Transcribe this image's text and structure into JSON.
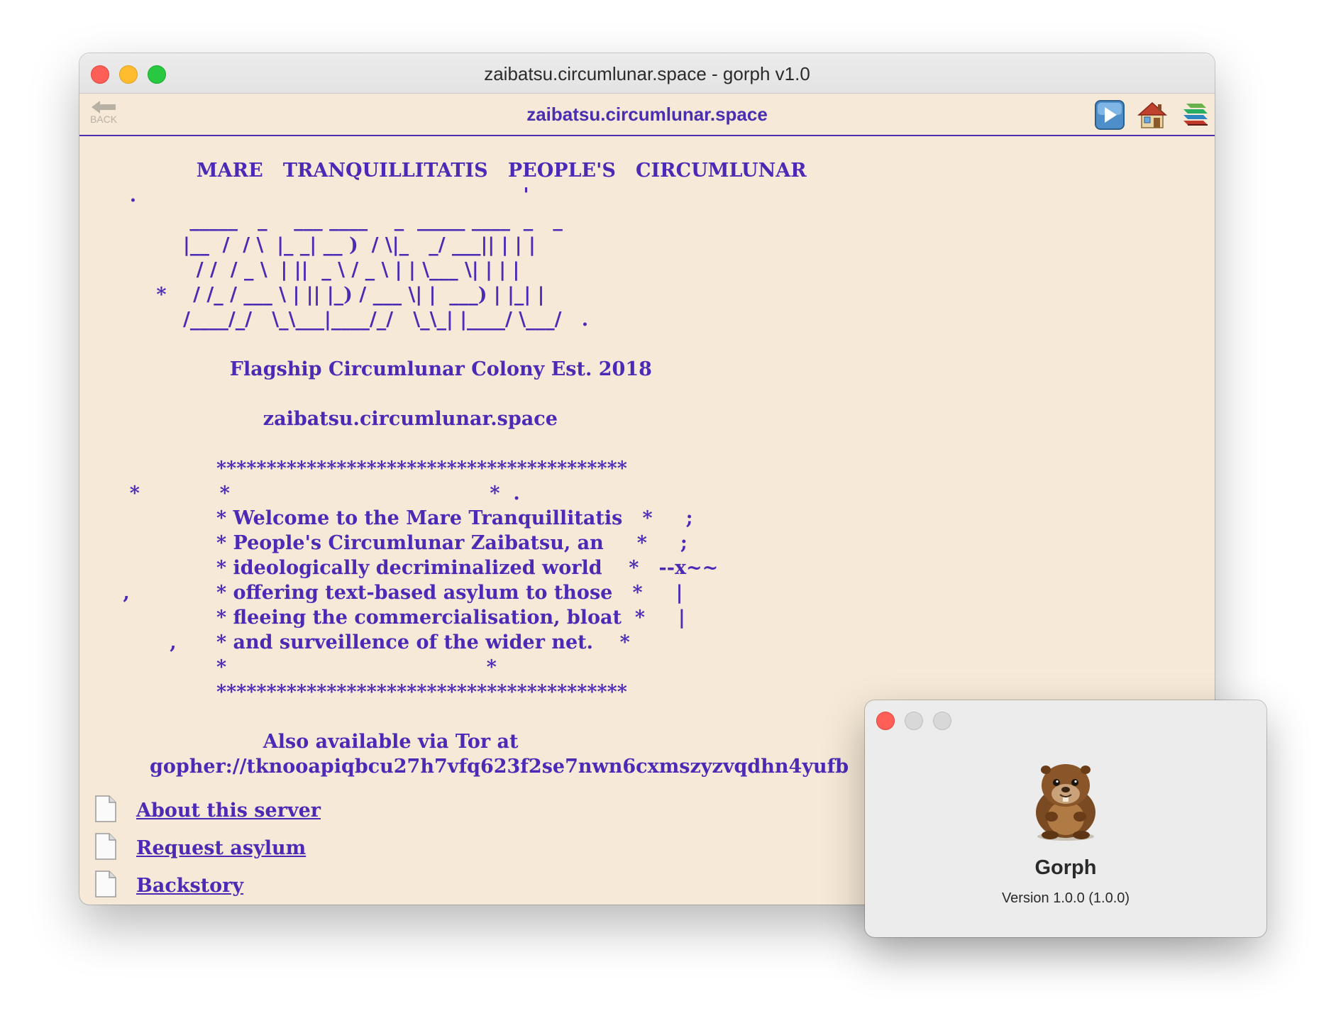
{
  "window": {
    "title": "zaibatsu.circumlunar.space - gorph v1.0"
  },
  "toolbar": {
    "back_label": "BACK",
    "address": "zaibatsu.circumlunar.space",
    "icons": [
      "play-icon",
      "home-icon",
      "bookmarks-icon"
    ]
  },
  "content": {
    "ascii_text": "            MARE   TRANQUILLITATIS   PEOPLE'S   CIRCUMLUNAR\n  .                                                          '\n           _____   _    ___ ____    _  _____ ____  _   _\n          |__  /  / \\  |_ _| __ )  / \\|_   _/ ___|| | | |\n            / /  / _ \\  | ||  _ \\ / _ \\ | | \\___ \\| | | |\n      *    / /_ / ___ \\ | || |_) / ___ \\| |  ___) | |_| |\n          /____/_/   \\_\\___|____/_/   \\_\\_| |____/ \\___/   .\n\n                 Flagship Circumlunar Colony Est. 2018\n\n                      zaibatsu.circumlunar.space\n\n               *****************************************\n  *            *                                       *  .\n               * Welcome to the Mare Tranquillitatis   *     ;\n               * People's Circumlunar Zaibatsu, an     *     ;\n               * ideologically decriminalized world    *   --x~~\n ,             * offering text-based asylum to those   *     |\n               * fleeing the commercialisation, bloat  *     |\n        ,      * and surveillence of the wider net.    *\n               *                                       *\n               *****************************************\n\n                      Also available via Tor at\n     gopher://tknooapiqbcu27h7vfq623f2se7nwn6cxmszyzvqdhn4yufb",
    "menu": [
      {
        "label": "About this server"
      },
      {
        "label": "Request asylum"
      },
      {
        "label": "Backstory"
      }
    ]
  },
  "about_dialog": {
    "app_name": "Gorph",
    "version": "Version 1.0.0 (1.0.0)"
  },
  "colors": {
    "content_text": "#4b2bb5",
    "background": "#f6e9d7",
    "toolbar_rule": "#4a2eb0"
  }
}
